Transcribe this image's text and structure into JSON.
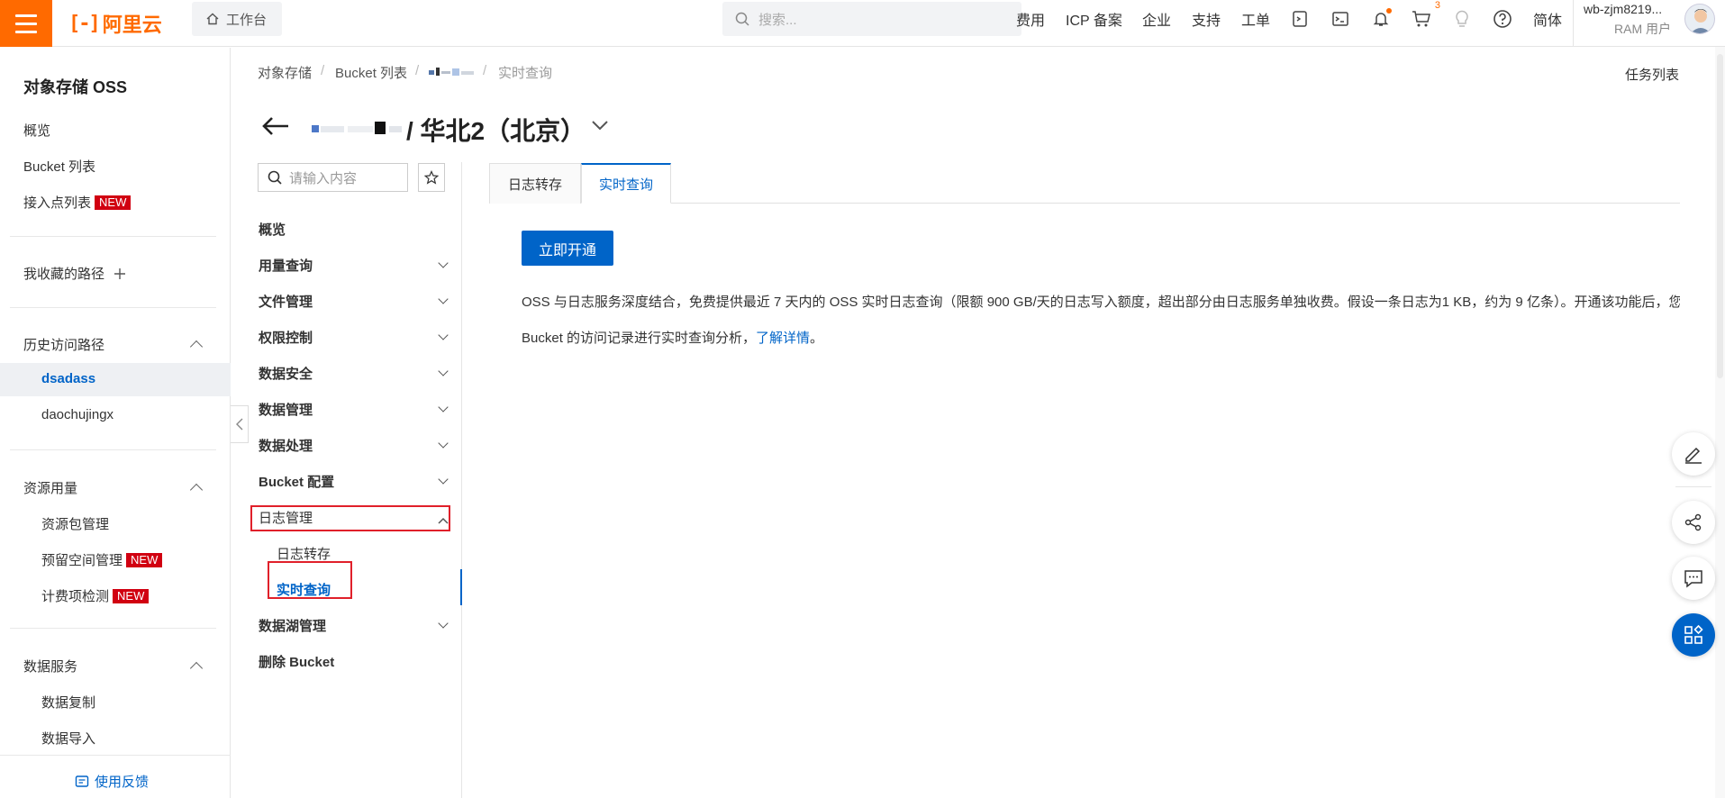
{
  "topbar": {
    "logo_text": "阿里云",
    "workbench_label": "工作台",
    "search_placeholder": "搜索...",
    "nav": [
      "费用",
      "ICP 备案",
      "企业",
      "支持",
      "工单"
    ],
    "cart_count": "3",
    "language": "简体",
    "user_name": "wb-zjm8219...",
    "user_role": "RAM 用户"
  },
  "sidebar": {
    "title": "对象存储 OSS",
    "items": [
      "概览",
      "Bucket 列表",
      "接入点列表"
    ],
    "new_tag": "NEW",
    "favorites_label": "我收藏的路径",
    "history": {
      "label": "历史访问路径",
      "items": [
        "dsadass",
        "daochujingx"
      ]
    },
    "resources": {
      "label": "资源用量",
      "items": [
        "资源包管理",
        "预留空间管理",
        "计费项检测"
      ]
    },
    "data_services": {
      "label": "数据服务",
      "items": [
        "数据复制",
        "数据导入"
      ]
    },
    "feedback": "使用反馈"
  },
  "breadcrumb": [
    "对象存储",
    "Bucket 列表",
    "实时查询"
  ],
  "tasks_label": "任务列表",
  "page_title": {
    "region": "/ 华北2（北京）"
  },
  "inner_nav": {
    "search_placeholder": "请输入内容",
    "items": [
      "概览",
      "用量查询",
      "文件管理",
      "权限控制",
      "数据安全",
      "数据管理",
      "数据处理",
      "Bucket 配置",
      "日志管理"
    ],
    "log_sub": [
      "日志转存",
      "实时查询"
    ],
    "after": [
      "数据湖管理",
      "删除 Bucket"
    ]
  },
  "tabs": [
    "日志转存",
    "实时查询"
  ],
  "content": {
    "button": "立即开通",
    "desc_line1": "OSS 与日志服务深度结合，免费提供最近 7 天内的 OSS 实时日志查询（限额 900 GB/天的日志写入额度，超出部分由日志服务单独收费。假设一条日志为1 KB，约为 9 亿条）。开通该功能后，您可",
    "desc_line2": "Bucket 的访问记录进行实时查询分析，",
    "desc_link": "了解详情",
    "desc_end": "。"
  },
  "colors": {
    "brand": "#ff6a00",
    "primary": "#0064c8",
    "new_tag": "#d10011",
    "highlight_box": "#e0202a"
  }
}
